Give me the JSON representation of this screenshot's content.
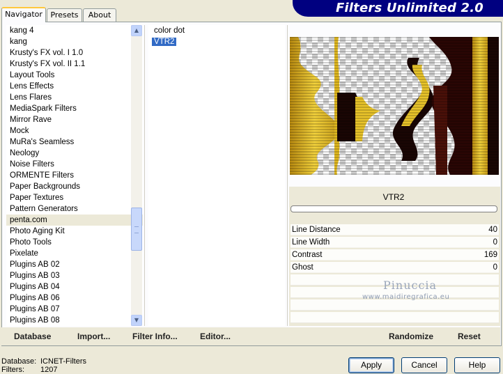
{
  "app": {
    "title": "Filters Unlimited 2.0"
  },
  "tabs": [
    {
      "label": "Navigator",
      "active": true
    },
    {
      "label": "Presets",
      "active": false
    },
    {
      "label": "About",
      "active": false
    }
  ],
  "categories": {
    "items": [
      "kang 4",
      "kang",
      "Krusty's FX vol. I 1.0",
      "Krusty's FX vol. II 1.1",
      "Layout Tools",
      "Lens Effects",
      "Lens Flares",
      "MediaSpark Filters",
      "Mirror Rave",
      "Mock",
      "MuRa's Seamless",
      "Neology",
      "Noise Filters",
      "ORMENTE Filters",
      "Paper Backgrounds",
      "Paper Textures",
      "Pattern Generators",
      "penta.com",
      "Photo Aging Kit",
      "Photo Tools",
      "Pixelate",
      "Plugins AB 02",
      "Plugins AB 03",
      "Plugins AB 04",
      "Plugins AB 06",
      "Plugins AB 07",
      "Plugins AB 08"
    ],
    "selected_index": 17
  },
  "filters": {
    "items": [
      "color dot",
      "VTR2"
    ],
    "selected_index": 1
  },
  "filter_panel": {
    "name": "VTR2",
    "params": [
      {
        "name": "Line Distance",
        "value": "40"
      },
      {
        "name": "Line Width",
        "value": "0"
      },
      {
        "name": "Contrast",
        "value": "169"
      },
      {
        "name": "Ghost",
        "value": "0"
      }
    ]
  },
  "watermark": {
    "name": "Pinuccia",
    "site": "www.maidiregrafica.eu"
  },
  "links": {
    "database": "Database",
    "import": "Import...",
    "filter_info": "Filter Info...",
    "editor": "Editor...",
    "randomize": "Randomize",
    "reset": "Reset"
  },
  "status": {
    "database_label": "Database:",
    "database_value": "ICNET-Filters",
    "filters_label": "Filters:",
    "filters_value": "1207"
  },
  "buttons": {
    "apply": "Apply",
    "cancel": "Cancel",
    "help": "Help"
  },
  "colors": {
    "banner": "#000080",
    "selection": "#316ac5",
    "gold": "#e8c020",
    "dark_brown": "#3a0a08"
  }
}
